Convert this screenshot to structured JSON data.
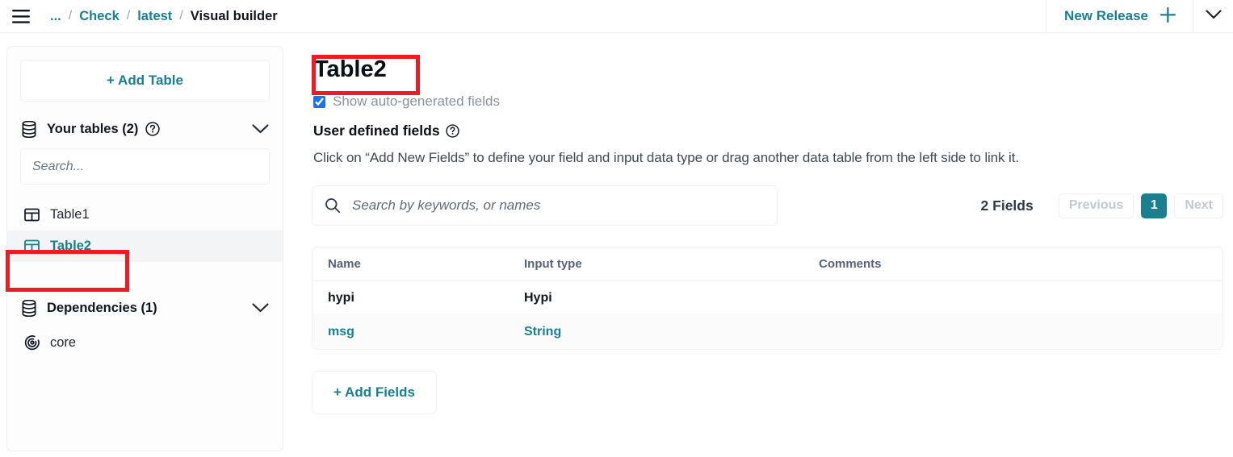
{
  "topbar": {
    "menu_icon": "hamburger-icon",
    "breadcrumb": [
      {
        "label": "...",
        "type": "link"
      },
      {
        "label": "Check",
        "type": "link"
      },
      {
        "label": "latest",
        "type": "link"
      },
      {
        "label": "Visual builder",
        "type": "current"
      }
    ],
    "separator": "/",
    "new_release_label": "New Release",
    "plus_icon": "plus-icon",
    "chevron_icon": "chevron-down-icon"
  },
  "sidebar": {
    "add_table_label": "+ Add Table",
    "tables_section": {
      "icon": "database-icon",
      "title": "Your tables (2)",
      "help_icon": "question-circle-icon",
      "chevron_icon": "chevron-down-icon"
    },
    "search_placeholder": "Search...",
    "search_value": "",
    "tables": [
      {
        "label": "Table1",
        "icon": "table-grid-icon",
        "active": false
      },
      {
        "label": "Table2",
        "icon": "table-grid-icon",
        "active": true
      }
    ],
    "deps_section": {
      "icon": "database-icon",
      "title": "Dependencies (1)",
      "chevron_icon": "chevron-down-icon"
    },
    "dependencies": [
      {
        "label": "core",
        "icon": "target-icon"
      }
    ]
  },
  "main": {
    "title": "Table2",
    "show_auto_label": "Show auto-generated fields",
    "show_auto_checked": true,
    "udf_title": "User defined fields",
    "udf_help_icon": "question-circle-icon",
    "udf_description": "Click on “Add New Fields” to define your field and input data type or drag another data table from the left side to link it.",
    "search": {
      "icon": "search-icon",
      "placeholder": "Search by keywords, or names",
      "value": ""
    },
    "pagination": {
      "count_label": "2 Fields",
      "previous_label": "Previous",
      "current_page": "1",
      "next_label": "Next"
    },
    "fields_table": {
      "columns": [
        "Name",
        "Input type",
        "Comments"
      ],
      "rows": [
        {
          "name": "hypi",
          "input_type": "Hypi",
          "comments": "",
          "style": "dark"
        },
        {
          "name": "msg",
          "input_type": "String",
          "comments": "",
          "style": "teal"
        }
      ]
    },
    "add_fields_label": "+ Add Fields"
  },
  "annotations": {
    "color": "#ee1b24",
    "boxes": [
      {
        "name": "title-highlight",
        "target": "Table2"
      },
      {
        "name": "sidebar-item-highlight",
        "target": "Table2"
      }
    ]
  }
}
